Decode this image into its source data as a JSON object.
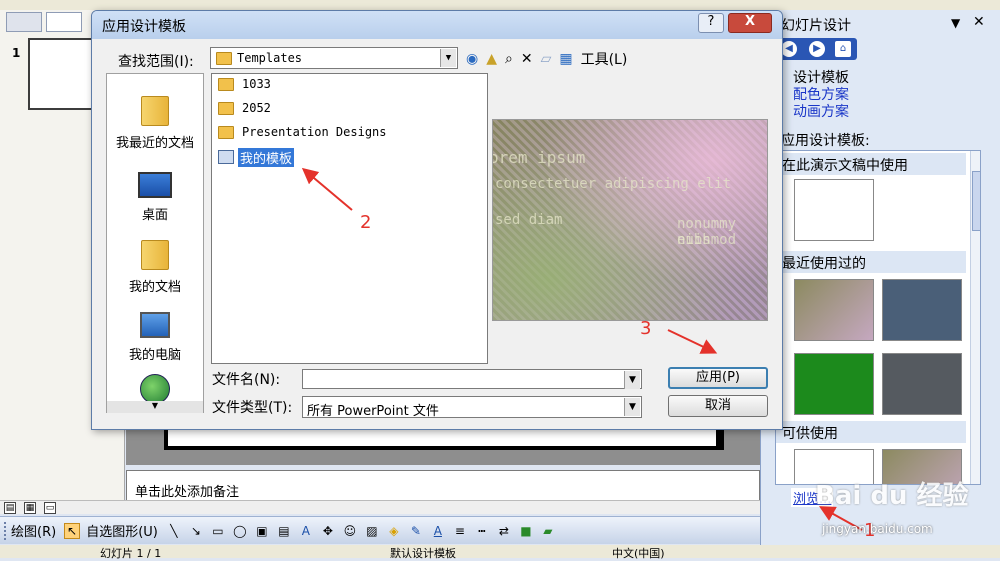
{
  "left_pane": {
    "slide_number": "1"
  },
  "notes_placeholder": "单击此处添加备注",
  "draw_toolbar": {
    "draw": "绘图(R)",
    "autoshape": "自选图形(U)"
  },
  "status": {
    "slide": "幻灯片 1 / 1",
    "design": "默认设计模板",
    "lang": "中文(中国)"
  },
  "taskpane": {
    "title": "幻灯片设计",
    "links": [
      "设计模板",
      "配色方案",
      "动画方案"
    ],
    "apply_label": "应用设计模板:",
    "sections": [
      "在此演示文稿中使用",
      "最近使用过的",
      "可供使用"
    ],
    "browse": "浏览..."
  },
  "dialog": {
    "title": "应用设计模板",
    "help": "?",
    "close": "X",
    "lookin_label": "查找范围(I):",
    "lookin_value": "Templates",
    "tools": "工具(L)",
    "places": [
      "我最近的文档",
      "桌面",
      "我的文档",
      "我的电脑"
    ],
    "files": [
      "1033",
      "2052",
      "Presentation Designs"
    ],
    "selected_file": "我的模板",
    "filename_label": "文件名(N):",
    "filename_value": "",
    "filetype_label": "文件类型(T):",
    "filetype_value": "所有 PowerPoint 文件",
    "apply_button": "应用(P)",
    "cancel_button": "取消",
    "preview_text": [
      "orem ipsum",
      "consectetuer adipiscing elit",
      "sed diam",
      "nonummy nibh",
      "euismod"
    ]
  },
  "annotations": {
    "n1": "1",
    "n2": "2",
    "n3": "3"
  },
  "watermark": {
    "brand": "Bai du 经验",
    "url": "jingyan.baidu.com"
  }
}
